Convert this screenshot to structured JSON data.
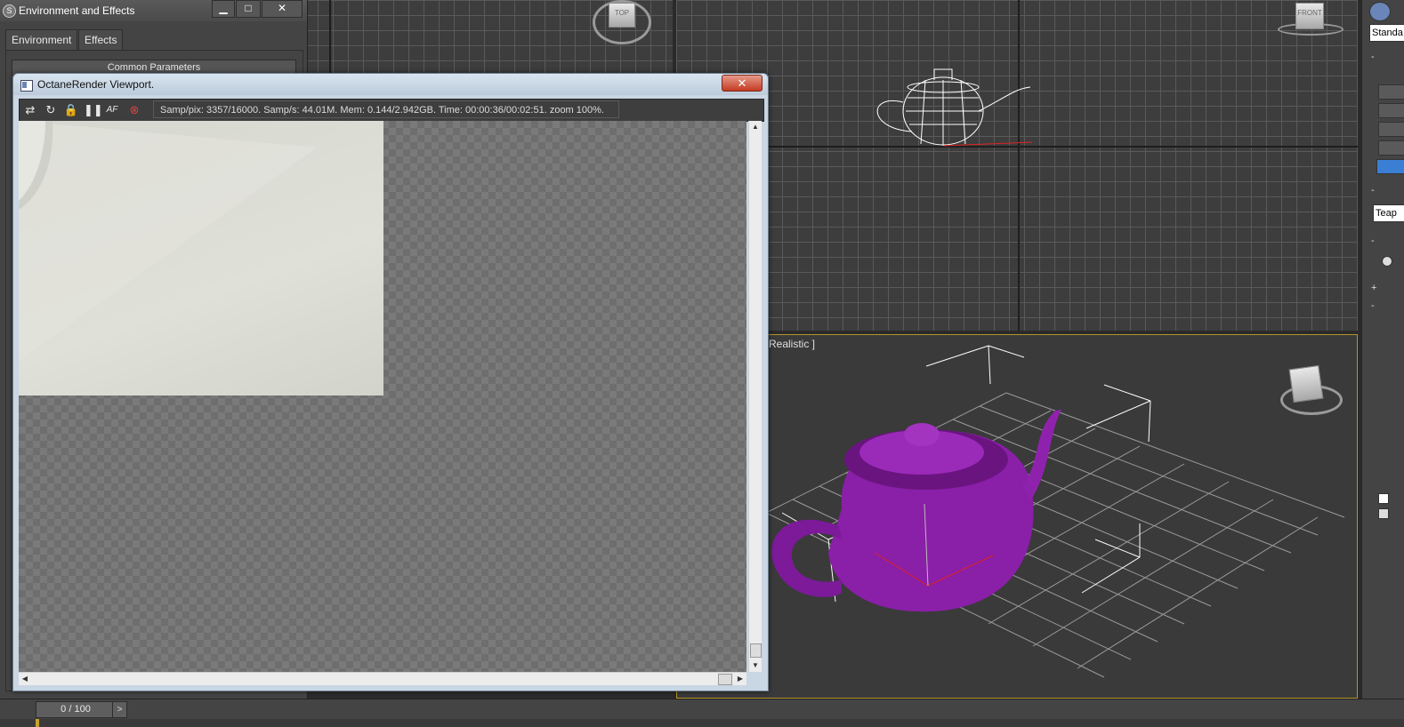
{
  "env_window": {
    "title": "Environment and Effects",
    "minimize": "▁",
    "maximize": "□",
    "close": "✕",
    "tabs": [
      "Environment",
      "Effects"
    ],
    "rollout": "Common Parameters"
  },
  "octane_window": {
    "title": "OctaneRender Viewport.",
    "close": "✕",
    "status": "Samp/pix: 3357/16000.  Samp/s: 44.01M.  Mem: 0.144/2.942GB.  Time: 00:00:36/00:02:51.  zoom 100%."
  },
  "viewports": {
    "top_cube": "TOP",
    "front_cube": "FRONT",
    "persp_label": "Realistic ]",
    "colors": {
      "teapot": "#8a1fa8",
      "active_border": "#b5942a"
    }
  },
  "command_panel": {
    "dropdown": "Standa",
    "name_field": "Teap"
  },
  "timebar": {
    "slider": "0 / 100",
    "next": ">"
  }
}
